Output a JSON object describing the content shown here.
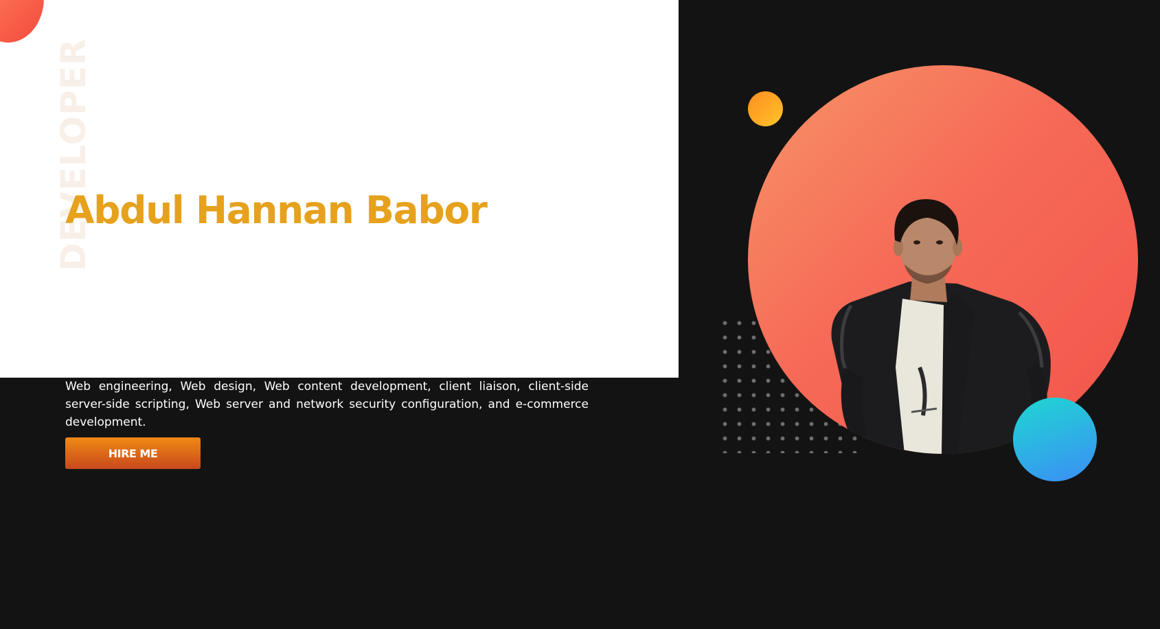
{
  "hero": {
    "background_word": "DEVELOPER",
    "name": "Abdul Hannan Babor",
    "description": "Web engineering, Web design, Web content development, client liaison, client-side server-side scripting, Web server and network security configuration, and e-commerce development.",
    "cta_label": "HIRE ME"
  },
  "portrait": {
    "icon": "profile-photo"
  },
  "colors": {
    "page_background": "#131313",
    "panel_background": "#ffffff",
    "name_color": "#e6a11d",
    "button_gradient": [
      "#f08a14",
      "#c8481c"
    ],
    "portrait_circle_gradient": [
      "#f79468",
      "#f2544a"
    ],
    "accent_yellow": "#ffb826",
    "accent_blue": "#2eb3e6"
  }
}
